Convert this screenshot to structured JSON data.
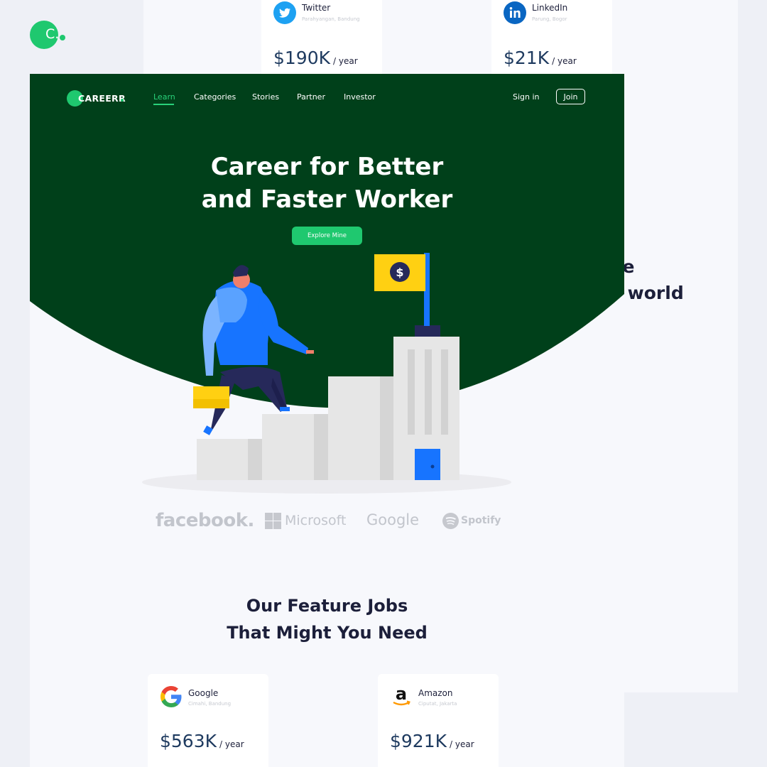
{
  "badge": {
    "letter": "C."
  },
  "back_page": {
    "title_line1": "ple",
    "title_line2": "e world",
    "cards": [
      {
        "company": "Twitter",
        "location": "Parahyangan, Bandung",
        "salary": "$190K",
        "period": "/ year",
        "icon": "twitter-icon"
      },
      {
        "company": "LinkedIn",
        "location": "Parung, Bogor",
        "salary": "$21K",
        "period": "/ year",
        "icon": "linkedin-icon"
      }
    ]
  },
  "nav": {
    "logo": "CAREERR",
    "links": [
      "Learn",
      "Categories",
      "Stories",
      "Partner",
      "Investor"
    ],
    "signin": "Sign in",
    "join": "Join"
  },
  "hero": {
    "title_line1": "Career for Better",
    "title_line2": "and Faster Worker",
    "cta": "Explore Mine",
    "flag_symbol": "$"
  },
  "brands": [
    "facebook.",
    "Microsoft",
    "Google",
    "Spotify"
  ],
  "features": {
    "title_line1": "Our Feature Jobs",
    "title_line2": "That Might You Need",
    "cards": [
      {
        "company": "Google",
        "location": "Cimahi, Bandung",
        "salary": "$563K",
        "period": "/ year",
        "icon": "google-icon"
      },
      {
        "company": "Amazon",
        "location": "Ciputat, Jakarta",
        "salary": "$921K",
        "period": "/ year",
        "icon": "amazon-icon"
      }
    ]
  },
  "colors": {
    "hero_green": "#00401a",
    "accent_green": "#1fc86f",
    "salary_blue": "#1e3a5f",
    "person_blue": "#1774ff"
  }
}
